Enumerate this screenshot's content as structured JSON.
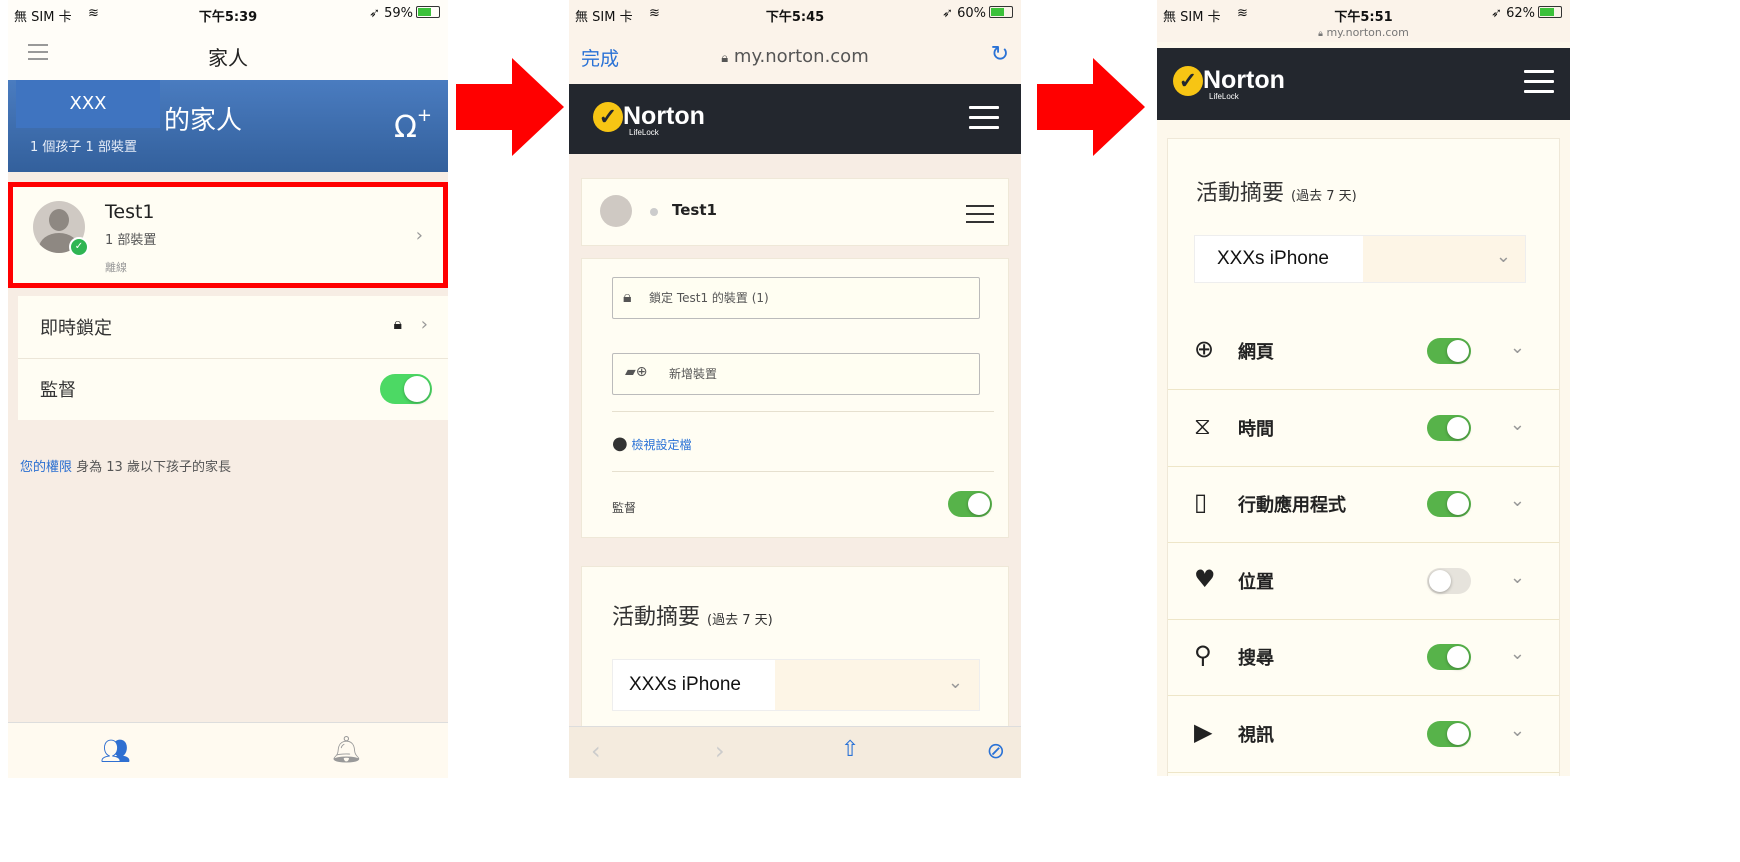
{
  "screen1": {
    "status": {
      "carrier": "無 SIM 卡",
      "time": "下午5:39",
      "battery": "59%"
    },
    "nav_title": "家人",
    "family": {
      "name_masked": "XXX",
      "title": "的家人",
      "summary": "1 個孩子 1 部裝置"
    },
    "child": {
      "name": "Test1",
      "devices": "1 部裝置",
      "state": "離線"
    },
    "instant_lock": "即時鎖定",
    "supervise": "監督",
    "rights_link": "您的權限",
    "rights_text": "身為 13 歲以下孩子的家長"
  },
  "screen2": {
    "status": {
      "carrier": "無 SIM 卡",
      "time": "下午5:45",
      "battery": "60%"
    },
    "done": "完成",
    "url": "my.norton.com",
    "brand": "Norton",
    "brand_sub": "LifeLock",
    "child_name": "Test1",
    "lock_device": "鎖定 Test1 的裝置 (1)",
    "add_device": "新增裝置",
    "view_profile": "檢視設定檔",
    "supervise": "監督",
    "activity_title": "活動摘要",
    "activity_range": "(過去 7 天)",
    "device_select": "XXXs iPhone"
  },
  "screen3": {
    "status": {
      "carrier": "無 SIM 卡",
      "time": "下午5:51",
      "battery": "62%"
    },
    "url": "my.norton.com",
    "brand": "Norton",
    "brand_sub": "LifeLock",
    "activity_title": "活動摘要",
    "activity_range": "(過去 7 天)",
    "device_select": "XXXs iPhone",
    "rules": [
      {
        "label": "網頁",
        "icon": "globe-icon",
        "on": true
      },
      {
        "label": "時間",
        "icon": "hourglass-icon",
        "on": true
      },
      {
        "label": "行動應用程式",
        "icon": "phone-app-icon",
        "on": true
      },
      {
        "label": "位置",
        "icon": "location-pin-icon",
        "on": false
      },
      {
        "label": "搜尋",
        "icon": "search-icon",
        "on": true
      },
      {
        "label": "視訊",
        "icon": "video-icon",
        "on": true
      }
    ]
  },
  "colors": {
    "arrow": "#ff0000",
    "toggle_on": "#4cd964",
    "norton_bar": "#23272e",
    "norton_yellow": "#f7c514",
    "family_header": "#3d6aa8"
  }
}
